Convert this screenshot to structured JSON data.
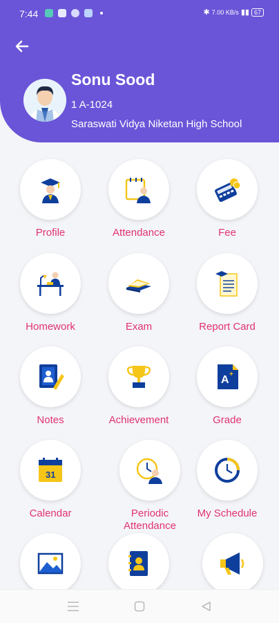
{
  "status": {
    "time": "7:44",
    "network": "7.00 KB/s",
    "battery": "67"
  },
  "profile": {
    "name": "Sonu Sood",
    "class": "1 A-1024",
    "school": "Saraswati Vidya Niketan High School"
  },
  "tiles": [
    {
      "label": "Profile",
      "icon": "graduate-icon"
    },
    {
      "label": "Attendance",
      "icon": "attendance-icon"
    },
    {
      "label": "Fee",
      "icon": "fee-calculator-icon"
    },
    {
      "label": "Homework",
      "icon": "homework-desk-icon"
    },
    {
      "label": "Exam",
      "icon": "exam-book-icon"
    },
    {
      "label": "Report Card",
      "icon": "report-card-icon"
    },
    {
      "label": "Notes",
      "icon": "notes-icon"
    },
    {
      "label": "Achievement",
      "icon": "trophy-icon"
    },
    {
      "label": "Grade",
      "icon": "grade-icon"
    },
    {
      "label": "Calendar",
      "icon": "calendar-icon",
      "day": "31"
    },
    {
      "label": "Periodic Attendance",
      "line1": "Periodic",
      "line2": "Attendance",
      "icon": "periodic-attendance-icon"
    },
    {
      "label": "My Schedule",
      "icon": "schedule-clock-icon"
    },
    {
      "label": "",
      "icon": "gallery-icon"
    },
    {
      "label": "",
      "icon": "contacts-book-icon"
    },
    {
      "label": "",
      "icon": "megaphone-icon"
    }
  ],
  "navbar": {
    "icons": [
      "menu-icon",
      "home-square-icon",
      "back-triangle-icon"
    ]
  }
}
